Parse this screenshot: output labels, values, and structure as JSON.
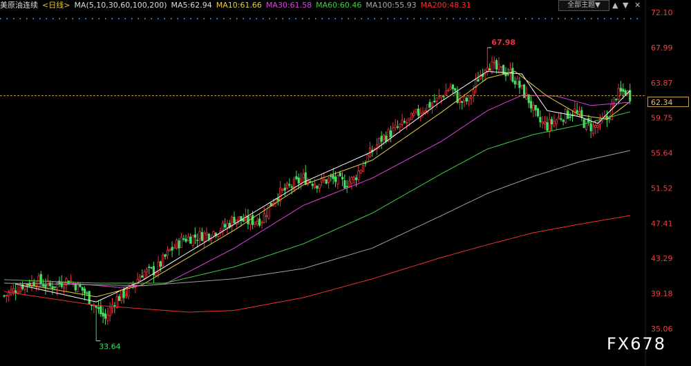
{
  "header": {
    "symbol": "美原油连续",
    "period": "<日线>",
    "ma_params": "MA(5,10,30,60,100,200)",
    "ma5": "MA5:62.94",
    "ma10": "MA10:61.66",
    "ma30": "MA30:61.58",
    "ma60": "MA60:60.46",
    "ma100": "MA100:55.93",
    "ma200": "MA200:48.31",
    "theme_label": "全部主题▼",
    "icons": [
      "up-arrow-icon",
      "down-arrow-icon",
      "close-icon"
    ]
  },
  "current_price": "62.34",
  "watermark": "FX678",
  "colors": {
    "up": "#f03040",
    "down": "#40e060",
    "ma5": "#ffffff",
    "ma10": "#e8d040",
    "ma30": "#e040e0",
    "ma60": "#40d040",
    "ma100": "#a0a0a0",
    "ma200": "#f03030",
    "axis_text": "#f04040",
    "dotted_line": "#3090ff",
    "price_line": "#c8a040"
  },
  "chart_data": {
    "type": "candlestick",
    "title": "美原油连续 <日线>",
    "ylim": [
      35.06,
      72.1
    ],
    "y_ticks": [
      "72.10",
      "67.99",
      "63.87",
      "59.75",
      "55.64",
      "51.52",
      "47.41",
      "43.29",
      "39.18",
      "35.06"
    ],
    "high_label": "67.98",
    "low_label": "33.64",
    "last_price": 62.34,
    "ma_lines": [
      {
        "name": "MA5",
        "last": 62.94
      },
      {
        "name": "MA10",
        "last": 61.66
      },
      {
        "name": "MA30",
        "last": 61.58
      },
      {
        "name": "MA60",
        "last": 60.46
      },
      {
        "name": "MA100",
        "last": 55.93
      },
      {
        "name": "MA200",
        "last": 48.31
      }
    ],
    "anchors": [
      [
        0,
        38.9
      ],
      [
        8,
        40.2
      ],
      [
        14,
        40.7
      ],
      [
        20,
        40.0
      ],
      [
        28,
        40.8
      ],
      [
        34,
        39.6
      ],
      [
        40,
        37.5
      ],
      [
        44,
        36.2
      ],
      [
        48,
        38.4
      ],
      [
        54,
        39.5
      ],
      [
        60,
        41.6
      ],
      [
        66,
        41.9
      ],
      [
        72,
        44.2
      ],
      [
        78,
        45.6
      ],
      [
        84,
        45.9
      ],
      [
        90,
        46.3
      ],
      [
        96,
        47.0
      ],
      [
        100,
        48.0
      ],
      [
        106,
        47.6
      ],
      [
        112,
        47.9
      ],
      [
        118,
        50.6
      ],
      [
        124,
        51.6
      ],
      [
        130,
        52.7
      ],
      [
        136,
        52.1
      ],
      [
        142,
        52.6
      ],
      [
        148,
        52.1
      ],
      [
        152,
        52.6
      ],
      [
        158,
        55.2
      ],
      [
        164,
        57.3
      ],
      [
        170,
        58.4
      ],
      [
        176,
        59.4
      ],
      [
        182,
        60.8
      ],
      [
        188,
        61.8
      ],
      [
        194,
        63.4
      ],
      [
        198,
        61.6
      ],
      [
        202,
        61.8
      ],
      [
        206,
        64.4
      ],
      [
        210,
        66.2
      ],
      [
        214,
        65.4
      ],
      [
        220,
        65.0
      ],
      [
        224,
        63.4
      ],
      [
        228,
        61.8
      ],
      [
        232,
        59.4
      ],
      [
        236,
        58.8
      ],
      [
        242,
        59.9
      ],
      [
        248,
        60.5
      ],
      [
        252,
        59.2
      ],
      [
        256,
        58.6
      ],
      [
        262,
        59.6
      ],
      [
        266,
        62.4
      ],
      [
        270,
        62.9
      ],
      [
        272,
        62.34
      ]
    ],
    "ma_anchors": {
      "MA5": [
        [
          5,
          40.3
        ],
        [
          40,
          38.2
        ],
        [
          60,
          40.7
        ],
        [
          100,
          47.3
        ],
        [
          130,
          52.2
        ],
        [
          160,
          55.8
        ],
        [
          190,
          61.7
        ],
        [
          210,
          65.2
        ],
        [
          225,
          64.9
        ],
        [
          236,
          60.6
        ],
        [
          250,
          59.9
        ],
        [
          258,
          59.1
        ],
        [
          272,
          62.94
        ]
      ],
      "MA10": [
        [
          10,
          40.2
        ],
        [
          40,
          38.8
        ],
        [
          60,
          40.2
        ],
        [
          100,
          46.6
        ],
        [
          130,
          51.9
        ],
        [
          160,
          54.8
        ],
        [
          190,
          60.4
        ],
        [
          210,
          64.4
        ],
        [
          222,
          65.2
        ],
        [
          236,
          62.3
        ],
        [
          250,
          60.1
        ],
        [
          262,
          59.6
        ],
        [
          272,
          61.66
        ]
      ],
      "MA30": [
        [
          20,
          40.6
        ],
        [
          50,
          39.9
        ],
        [
          70,
          40.3
        ],
        [
          100,
          44.5
        ],
        [
          130,
          49.5
        ],
        [
          160,
          52.7
        ],
        [
          190,
          57.0
        ],
        [
          210,
          60.6
        ],
        [
          225,
          62.4
        ],
        [
          240,
          62.3
        ],
        [
          255,
          61.2
        ],
        [
          272,
          61.58
        ]
      ],
      "MA60": [
        [
          0,
          40.8
        ],
        [
          40,
          40.4
        ],
        [
          70,
          40.4
        ],
        [
          100,
          42.3
        ],
        [
          130,
          45.0
        ],
        [
          160,
          48.6
        ],
        [
          190,
          53.2
        ],
        [
          210,
          56.1
        ],
        [
          230,
          57.8
        ],
        [
          250,
          58.9
        ],
        [
          272,
          60.46
        ]
      ],
      "MA100": [
        [
          0,
          40.4
        ],
        [
          60,
          40.1
        ],
        [
          100,
          40.9
        ],
        [
          130,
          42.1
        ],
        [
          160,
          44.5
        ],
        [
          190,
          48.3
        ],
        [
          210,
          50.9
        ],
        [
          230,
          52.9
        ],
        [
          250,
          54.6
        ],
        [
          272,
          55.93
        ]
      ],
      "MA200": [
        [
          0,
          39.4
        ],
        [
          40,
          37.8
        ],
        [
          80,
          37.0
        ],
        [
          100,
          37.2
        ],
        [
          130,
          38.7
        ],
        [
          160,
          40.9
        ],
        [
          190,
          43.4
        ],
        [
          210,
          44.9
        ],
        [
          230,
          46.3
        ],
        [
          250,
          47.3
        ],
        [
          272,
          48.31
        ]
      ]
    }
  }
}
